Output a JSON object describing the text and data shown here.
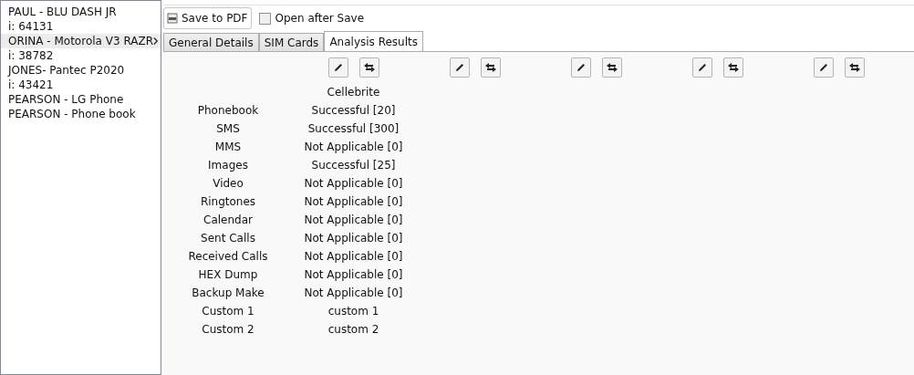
{
  "device_list": [
    {
      "name": "PAUL - BLU DASH JR",
      "id": "i: 64131",
      "selected": false
    },
    {
      "name": "ORINA - Motorola V3 RAZR",
      "id": "i: 38782",
      "selected": true
    },
    {
      "name": "JONES- Pantec P2020",
      "id": "i: 43421",
      "selected": false
    },
    {
      "name": "PEARSON - LG Phone",
      "selected": false
    },
    {
      "name": "PEARSON - Phone book",
      "selected": false
    }
  ],
  "toolbar": {
    "save_button": "Save to PDF",
    "open_after_save": {
      "label": "Open after Save",
      "checked": false
    }
  },
  "tabs": [
    {
      "label": "General Details",
      "selected": false
    },
    {
      "label": "SIM Cards",
      "selected": false
    },
    {
      "label": "Analysis Results",
      "selected": true
    }
  ],
  "row_labels": [
    "Phonebook",
    "SMS",
    "MMS",
    "Images",
    "Video",
    "Ringtones",
    "Calendar",
    "Sent Calls",
    "Received Calls",
    "HEX Dump",
    "Backup Make",
    "Custom 1",
    "Custom 2"
  ],
  "result_columns": [
    {
      "kind": "source",
      "header": "Cellebrite",
      "values": [
        "Successful [20]",
        "Successful [300]",
        "Not Applicable [0]",
        "Successful [25]",
        "Not Applicable [0]",
        "Not Applicable [0]",
        "Not Applicable [0]",
        "Not Applicable [0]",
        "Not Applicable [0]",
        "Not Applicable [0]",
        "Not Applicable [0]",
        "custom 1",
        "custom 2"
      ]
    },
    {
      "kind": "empty"
    },
    {
      "kind": "empty"
    },
    {
      "kind": "empty"
    },
    {
      "kind": "empty"
    }
  ]
}
